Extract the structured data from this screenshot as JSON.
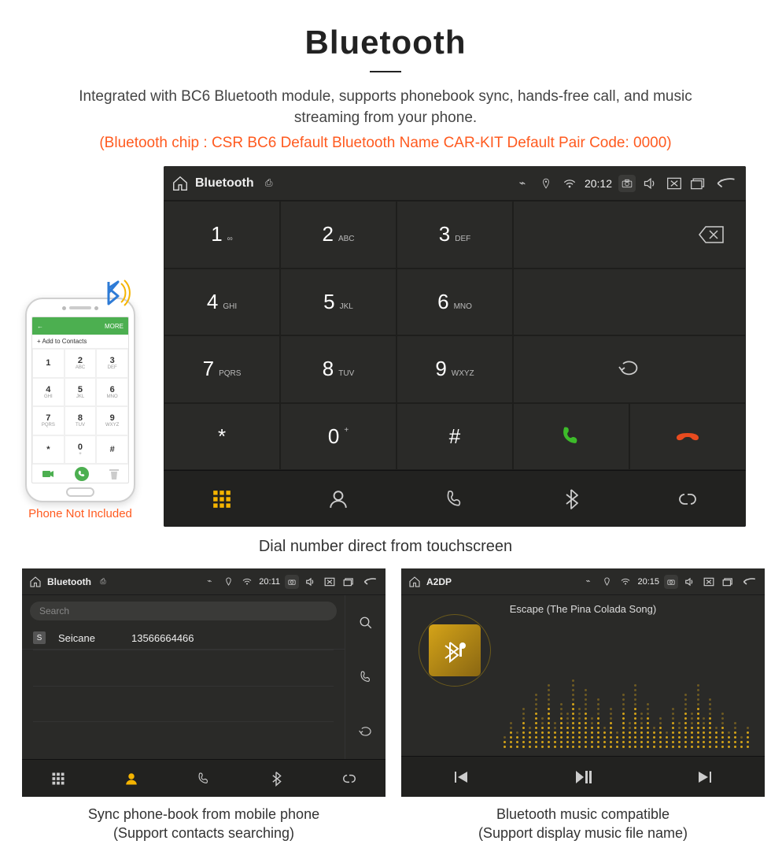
{
  "header": {
    "title": "Bluetooth",
    "desc": "Integrated with BC6 Bluetooth module, supports phonebook sync, hands-free call, and music streaming from your phone.",
    "spec": "(Bluetooth chip : CSR BC6    Default Bluetooth Name CAR-KIT    Default Pair Code: 0000)"
  },
  "phone": {
    "notIncluded": "Phone Not Included",
    "greenLeft": "←",
    "greenRight": "MORE",
    "addContacts": "+  Add to Contacts",
    "keys": [
      {
        "n": "1",
        "s": ""
      },
      {
        "n": "2",
        "s": "ABC"
      },
      {
        "n": "3",
        "s": "DEF"
      },
      {
        "n": "4",
        "s": "GHI"
      },
      {
        "n": "5",
        "s": "JKL"
      },
      {
        "n": "6",
        "s": "MNO"
      },
      {
        "n": "7",
        "s": "PQRS"
      },
      {
        "n": "8",
        "s": "TUV"
      },
      {
        "n": "9",
        "s": "WXYZ"
      },
      {
        "n": "*",
        "s": ""
      },
      {
        "n": "0",
        "s": "+"
      },
      {
        "n": "#",
        "s": ""
      }
    ]
  },
  "main": {
    "topbar": {
      "title": "Bluetooth",
      "time": "20:12"
    },
    "keys": [
      {
        "n": "1",
        "s": "∞"
      },
      {
        "n": "2",
        "s": "ABC"
      },
      {
        "n": "3",
        "s": "DEF"
      },
      {
        "n": "4",
        "s": "GHI"
      },
      {
        "n": "5",
        "s": "JKL"
      },
      {
        "n": "6",
        "s": "MNO"
      },
      {
        "n": "7",
        "s": "PQRS"
      },
      {
        "n": "8",
        "s": "TUV"
      },
      {
        "n": "9",
        "s": "WXYZ"
      },
      {
        "n": "*",
        "s": ""
      },
      {
        "n": "0",
        "s": "+",
        "sup": true
      },
      {
        "n": "#",
        "s": ""
      }
    ],
    "caption": "Dial number direct from touchscreen"
  },
  "contacts": {
    "topbar": {
      "title": "Bluetooth",
      "time": "20:11"
    },
    "searchPlaceholder": "Search",
    "row": {
      "letter": "S",
      "name": "Seicane",
      "number": "13566664466"
    },
    "caption1": "Sync phone-book from mobile phone",
    "caption2": "(Support contacts searching)"
  },
  "music": {
    "topbar": {
      "title": "A2DP",
      "time": "20:15"
    },
    "track": "Escape (The Pina Colada Song)",
    "caption1": "Bluetooth music compatible",
    "caption2": "(Support display music file name)"
  }
}
